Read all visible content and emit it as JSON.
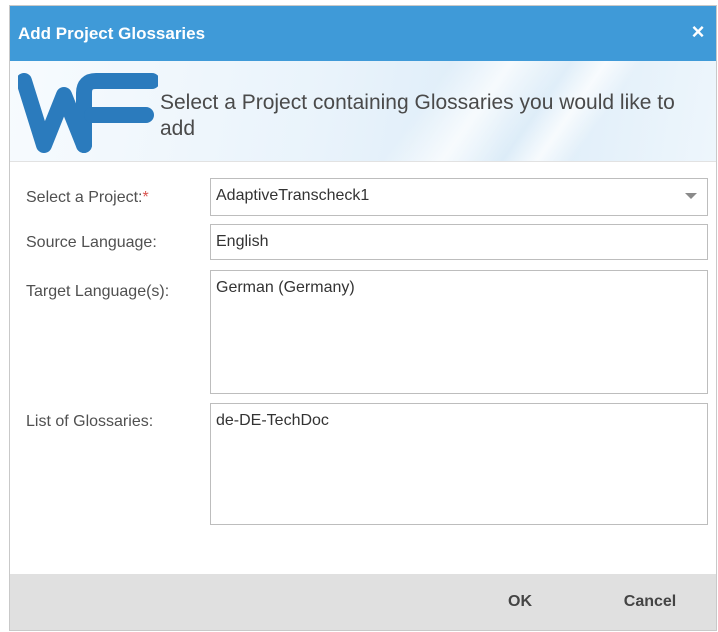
{
  "dialog": {
    "title": "Add Project Glossaries",
    "close_icon": "close-icon",
    "close_glyph": "×"
  },
  "banner": {
    "logo_icon": "wf-logo",
    "text": "Select a Project containing Glossaries you would like to add"
  },
  "form": {
    "project": {
      "label": "Select a Project:",
      "required_marker": "*",
      "value": "AdaptiveTranscheck1"
    },
    "source_language": {
      "label": "Source Language:",
      "value": "English"
    },
    "target_languages": {
      "label": "Target Language(s):",
      "value": "German  (Germany)"
    },
    "glossaries": {
      "label": "List of Glossaries:",
      "value": "de-DE-TechDoc"
    }
  },
  "footer": {
    "ok_label": "OK",
    "cancel_label": "Cancel"
  },
  "colors": {
    "title_bar": "#3f9ad8",
    "logo": "#2b7bbd",
    "required": "#d9534f",
    "footer": "#e0e0e0"
  }
}
